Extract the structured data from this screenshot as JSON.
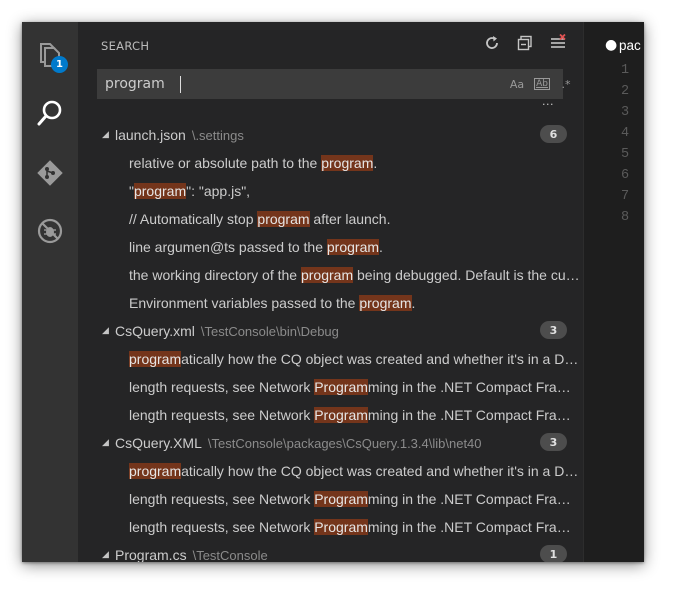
{
  "activity": {
    "explorer_badge": "1",
    "icons": [
      "files-icon",
      "search-icon",
      "git-icon",
      "debug-icon"
    ]
  },
  "panel": {
    "title": "SEARCH",
    "toolbar": [
      "refresh-icon",
      "collapse-all-icon",
      "clear-results-icon"
    ]
  },
  "search": {
    "value": "program",
    "options": {
      "case": "Aa",
      "word": "Ab",
      "regex": ".*"
    },
    "more": "..."
  },
  "results": {
    "files": [
      {
        "name": "launch.json",
        "path": "\\.settings",
        "count": "6",
        "matches": [
          [
            "relative or absolute path to the ",
            "program",
            "."
          ],
          [
            "\"",
            "program",
            "\": \"app.js\","
          ],
          [
            "// Automatically stop ",
            "program",
            " after launch."
          ],
          [
            "line argumen@ts passed to the ",
            "program",
            "."
          ],
          [
            "the working directory of the ",
            "program",
            " being debugged. Default is the current working directory."
          ],
          [
            "Environment variables passed to the ",
            "program",
            "."
          ]
        ]
      },
      {
        "name": "CsQuery.xml",
        "path": "\\TestConsole\\bin\\Debug",
        "count": "3",
        "matches": [
          [
            "",
            "program",
            "atically how the CQ object was created and whether it's in a DOM."
          ],
          [
            "length requests, see Network ",
            "Program",
            "ming in the .NET Compact Framework."
          ],
          [
            "length requests, see Network ",
            "Program",
            "ming in the .NET Compact Framework."
          ]
        ]
      },
      {
        "name": "CsQuery.XML",
        "path": "\\TestConsole\\packages\\CsQuery.1.3.4\\lib\\net40",
        "count": "3",
        "matches": [
          [
            "",
            "program",
            "atically how the CQ object was created and whether it's in a DOM."
          ],
          [
            "length requests, see Network ",
            "Program",
            "ming in the .NET Compact Framework."
          ],
          [
            "length requests, see Network ",
            "Program",
            "ming in the .NET Compact Framework."
          ]
        ]
      },
      {
        "name": "Program.cs",
        "path": "\\TestConsole",
        "count": "1",
        "matches": []
      }
    ]
  },
  "editor": {
    "tab_dot": "●",
    "tab_label": "pac",
    "line_numbers": [
      "1",
      "2",
      "3",
      "4",
      "5",
      "6",
      "7",
      "8"
    ]
  },
  "colors": {
    "highlight": "#74351b",
    "badge": "#007acc",
    "panel_bg": "#252526",
    "activity_bg": "#333333"
  }
}
